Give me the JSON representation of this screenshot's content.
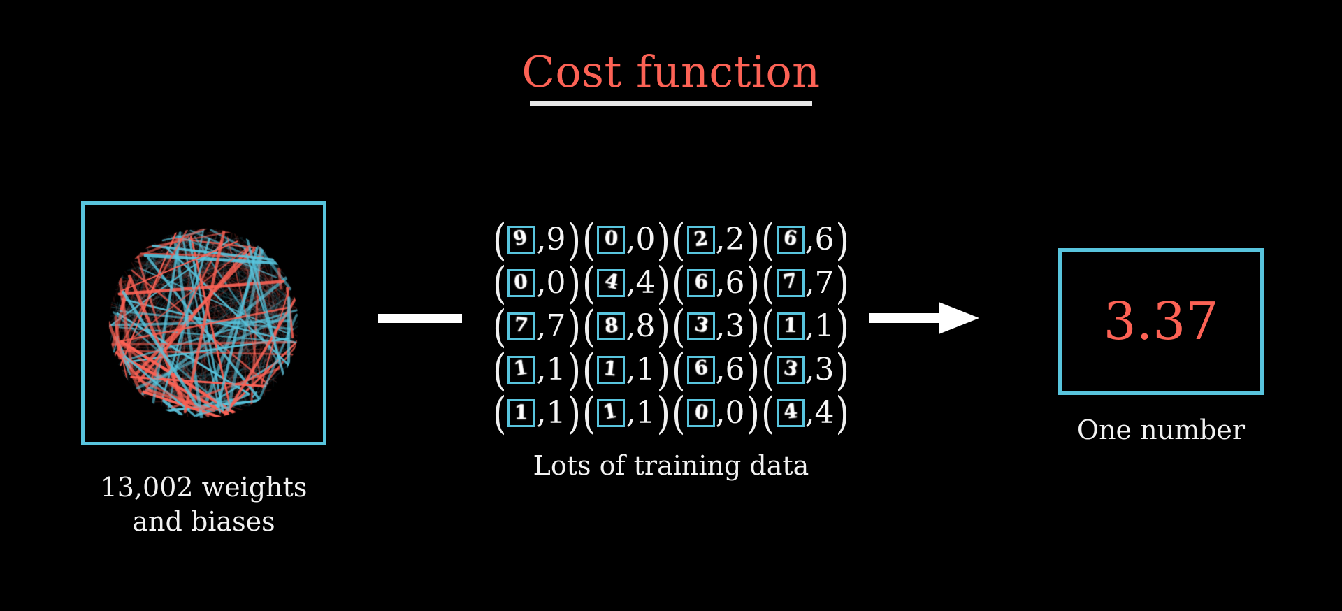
{
  "slide": {
    "background_color": "#000000",
    "accent_blue": "#58c4dd",
    "accent_red": "#fc6255",
    "text_color": "#ffffff"
  },
  "title": {
    "text": "Cost function",
    "color": "#fc6255",
    "underline_color": "#e8e8e8"
  },
  "weights": {
    "caption_line1": "13,002 weights",
    "caption_line2": "and biases",
    "box_border_color": "#58c4dd",
    "line_colors": [
      "#58c4dd",
      "#fc6255"
    ]
  },
  "connector": {
    "left_bar_color": "#ffffff",
    "right_arrow_color": "#ffffff"
  },
  "training": {
    "caption": "Lots of training data",
    "open_paren": "(",
    "close_paren": ")",
    "comma": ",",
    "rows": [
      [
        {
          "image_digit": "9",
          "label": "9"
        },
        {
          "image_digit": "0",
          "label": "0"
        },
        {
          "image_digit": "2",
          "label": "2"
        },
        {
          "image_digit": "6",
          "label": "6"
        }
      ],
      [
        {
          "image_digit": "0",
          "label": "0"
        },
        {
          "image_digit": "4",
          "label": "4"
        },
        {
          "image_digit": "6",
          "label": "6"
        },
        {
          "image_digit": "7",
          "label": "7"
        }
      ],
      [
        {
          "image_digit": "7",
          "label": "7"
        },
        {
          "image_digit": "8",
          "label": "8"
        },
        {
          "image_digit": "3",
          "label": "3"
        },
        {
          "image_digit": "1",
          "label": "1"
        }
      ],
      [
        {
          "image_digit": "1",
          "label": "1"
        },
        {
          "image_digit": "1",
          "label": "1"
        },
        {
          "image_digit": "6",
          "label": "6"
        },
        {
          "image_digit": "3",
          "label": "3"
        }
      ],
      [
        {
          "image_digit": "1",
          "label": "1"
        },
        {
          "image_digit": "1",
          "label": "1"
        },
        {
          "image_digit": "0",
          "label": "0"
        },
        {
          "image_digit": "4",
          "label": "4"
        }
      ]
    ]
  },
  "result": {
    "value": "3.37",
    "caption": "One number",
    "value_color": "#fc6255",
    "box_border_color": "#58c4dd"
  }
}
